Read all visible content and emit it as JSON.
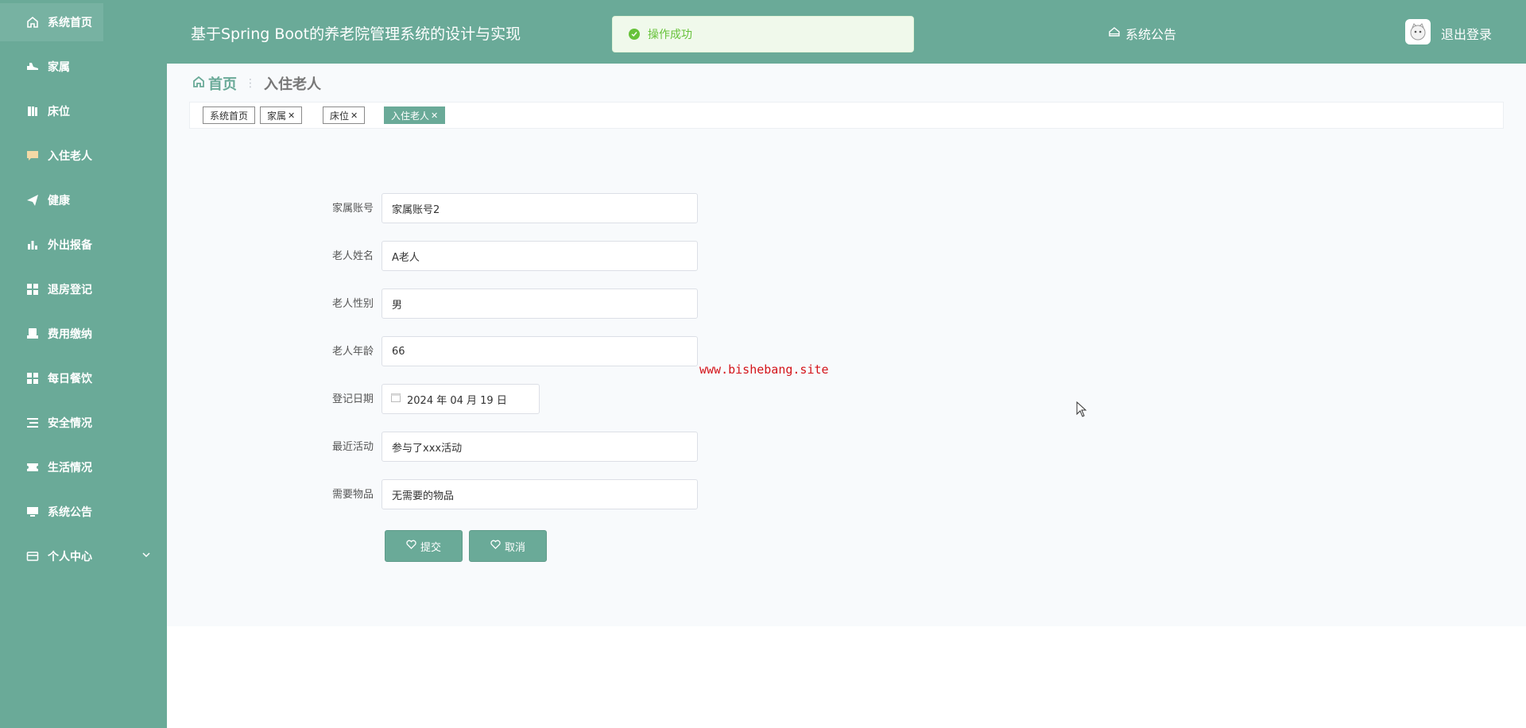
{
  "sidebar": {
    "items": [
      {
        "label": "系统首页",
        "icon": "home-icon"
      },
      {
        "label": "家属",
        "icon": "shoe-icon"
      },
      {
        "label": "床位",
        "icon": "book-icon"
      },
      {
        "label": "入住老人",
        "icon": "chat-icon"
      },
      {
        "label": "健康",
        "icon": "paper-plane-icon"
      },
      {
        "label": "外出报备",
        "icon": "bar-chart-icon"
      },
      {
        "label": "退房登记",
        "icon": "grid-icon"
      },
      {
        "label": "费用缴纳",
        "icon": "printer-icon"
      },
      {
        "label": "每日餐饮",
        "icon": "grid-icon"
      },
      {
        "label": "安全情况",
        "icon": "list-icon"
      },
      {
        "label": "生活情况",
        "icon": "ticket-icon"
      },
      {
        "label": "系统公告",
        "icon": "monitor-icon"
      },
      {
        "label": "个人中心",
        "icon": "card-icon"
      }
    ]
  },
  "header": {
    "title": "基于Spring Boot的养老院管理系统的设计与实现",
    "notice": "系统公告",
    "logout": "退出登录"
  },
  "toast": {
    "text": "操作成功"
  },
  "breadcrumb": {
    "home": "首页",
    "current": "入住老人"
  },
  "tags": [
    {
      "label": "系统首页",
      "closable": false,
      "active": false
    },
    {
      "label": "家属",
      "closable": true,
      "active": false
    },
    {
      "label": "床位",
      "closable": true,
      "active": false
    },
    {
      "label": "入住老人",
      "closable": true,
      "active": true
    }
  ],
  "form": {
    "fields": [
      {
        "label": "家属账号",
        "value": "家属账号2"
      },
      {
        "label": "老人姓名",
        "value": "A老人"
      },
      {
        "label": "老人性别",
        "value": "男"
      },
      {
        "label": "老人年龄",
        "value": "66"
      },
      {
        "label": "登记日期",
        "value": "2024 年 04 月 19 日"
      },
      {
        "label": "最近活动",
        "value": "参与了xxx活动"
      },
      {
        "label": "需要物品",
        "value": "无需要的物品"
      }
    ],
    "submit_label": "提交",
    "cancel_label": "取消"
  },
  "watermark": "www.bishebang.site",
  "colors": {
    "primary": "#6aaa98",
    "success": "#67c23a",
    "watermark": "#d4141a"
  }
}
